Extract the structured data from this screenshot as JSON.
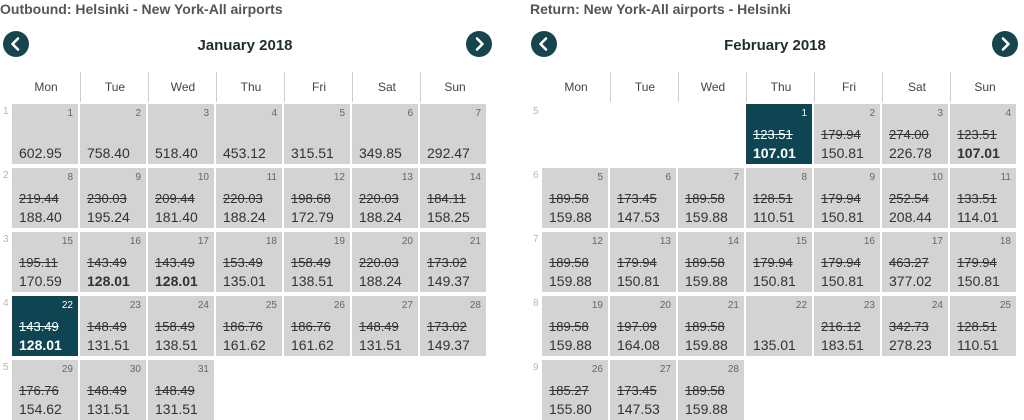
{
  "colors": {
    "accent": "#17454e",
    "selected_bg": "#0f4552",
    "cell_bg": "#d3d3d3"
  },
  "outbound": {
    "title": "Outbound:  Helsinki - New York-All airports",
    "month": "January 2018",
    "prev_icon": "chevron-left-icon",
    "next_icon": "chevron-right-icon",
    "weekdays": [
      "Mon",
      "Tue",
      "Wed",
      "Thu",
      "Fri",
      "Sat",
      "Sun"
    ],
    "weeks": [
      {
        "number": "1",
        "days": [
          {
            "day": "1",
            "price": "602.95"
          },
          {
            "day": "2",
            "price": "758.40"
          },
          {
            "day": "3",
            "price": "518.40"
          },
          {
            "day": "4",
            "price": "453.12"
          },
          {
            "day": "5",
            "price": "315.51"
          },
          {
            "day": "6",
            "price": "349.85"
          },
          {
            "day": "7",
            "price": "292.47"
          }
        ]
      },
      {
        "number": "2",
        "days": [
          {
            "day": "8",
            "old": "219.44",
            "price": "188.40"
          },
          {
            "day": "9",
            "old": "230.03",
            "price": "195.24"
          },
          {
            "day": "10",
            "old": "209.44",
            "price": "181.40"
          },
          {
            "day": "11",
            "old": "220.03",
            "price": "188.24"
          },
          {
            "day": "12",
            "old": "198.68",
            "price": "172.79"
          },
          {
            "day": "13",
            "old": "220.03",
            "price": "188.24"
          },
          {
            "day": "14",
            "old": "184.11",
            "price": "158.25"
          }
        ]
      },
      {
        "number": "3",
        "days": [
          {
            "day": "15",
            "old": "195.11",
            "price": "170.59"
          },
          {
            "day": "16",
            "old": "143.49",
            "price": "128.01",
            "bold": true
          },
          {
            "day": "17",
            "old": "143.49",
            "price": "128.01",
            "bold": true
          },
          {
            "day": "18",
            "old": "153.49",
            "price": "135.01"
          },
          {
            "day": "19",
            "old": "158.49",
            "price": "138.51"
          },
          {
            "day": "20",
            "old": "220.03",
            "price": "188.24"
          },
          {
            "day": "21",
            "old": "173.02",
            "price": "149.37"
          }
        ]
      },
      {
        "number": "4",
        "days": [
          {
            "day": "22",
            "old": "143.49",
            "price": "128.01",
            "bold": true,
            "selected": true
          },
          {
            "day": "23",
            "old": "148.49",
            "price": "131.51"
          },
          {
            "day": "24",
            "old": "158.49",
            "price": "138.51"
          },
          {
            "day": "25",
            "old": "186.76",
            "price": "161.62"
          },
          {
            "day": "26",
            "old": "186.76",
            "price": "161.62"
          },
          {
            "day": "27",
            "old": "148.49",
            "price": "131.51"
          },
          {
            "day": "28",
            "old": "173.02",
            "price": "149.37"
          }
        ]
      },
      {
        "number": "5",
        "days": [
          {
            "day": "29",
            "old": "176.76",
            "price": "154.62"
          },
          {
            "day": "30",
            "old": "148.49",
            "price": "131.51"
          },
          {
            "day": "31",
            "old": "148.49",
            "price": "131.51"
          },
          null,
          null,
          null,
          null
        ]
      }
    ]
  },
  "return": {
    "title": "Return:  New York-All airports - Helsinki",
    "month": "February 2018",
    "prev_icon": "chevron-left-icon",
    "next_icon": "chevron-right-icon",
    "weekdays": [
      "Mon",
      "Tue",
      "Wed",
      "Thu",
      "Fri",
      "Sat",
      "Sun"
    ],
    "weeks": [
      {
        "number": "5",
        "days": [
          null,
          null,
          null,
          {
            "day": "1",
            "old": "123.51",
            "price": "107.01",
            "bold": true,
            "selected": true
          },
          {
            "day": "2",
            "old": "179.94",
            "price": "150.81"
          },
          {
            "day": "3",
            "old": "274.00",
            "price": "226.78"
          },
          {
            "day": "4",
            "old": "123.51",
            "price": "107.01",
            "bold": true
          }
        ]
      },
      {
        "number": "6",
        "days": [
          {
            "day": "5",
            "old": "189.58",
            "price": "159.88"
          },
          {
            "day": "6",
            "old": "173.45",
            "price": "147.53"
          },
          {
            "day": "7",
            "old": "189.58",
            "price": "159.88"
          },
          {
            "day": "8",
            "old": "128.51",
            "price": "110.51"
          },
          {
            "day": "9",
            "old": "179.94",
            "price": "150.81"
          },
          {
            "day": "10",
            "old": "252.54",
            "price": "208.44"
          },
          {
            "day": "11",
            "old": "133.51",
            "price": "114.01"
          }
        ]
      },
      {
        "number": "7",
        "days": [
          {
            "day": "12",
            "old": "189.58",
            "price": "159.88"
          },
          {
            "day": "13",
            "old": "179.94",
            "price": "150.81"
          },
          {
            "day": "14",
            "old": "189.58",
            "price": "159.88"
          },
          {
            "day": "15",
            "old": "179.94",
            "price": "150.81"
          },
          {
            "day": "16",
            "old": "179.94",
            "price": "150.81"
          },
          {
            "day": "17",
            "old": "463.27",
            "price": "377.02"
          },
          {
            "day": "18",
            "old": "179.94",
            "price": "150.81"
          }
        ]
      },
      {
        "number": "8",
        "days": [
          {
            "day": "19",
            "old": "189.58",
            "price": "159.88"
          },
          {
            "day": "20",
            "old": "197.09",
            "price": "164.08"
          },
          {
            "day": "21",
            "old": "189.58",
            "price": "159.88"
          },
          {
            "day": "22",
            "price": "135.01"
          },
          {
            "day": "23",
            "old": "216.12",
            "price": "183.51"
          },
          {
            "day": "24",
            "old": "342.73",
            "price": "278.23"
          },
          {
            "day": "25",
            "old": "128.51",
            "price": "110.51"
          }
        ]
      },
      {
        "number": "9",
        "days": [
          {
            "day": "26",
            "old": "185.27",
            "price": "155.80"
          },
          {
            "day": "27",
            "old": "173.45",
            "price": "147.53"
          },
          {
            "day": "28",
            "old": "189.58",
            "price": "159.88"
          },
          null,
          null,
          null,
          null
        ]
      }
    ]
  }
}
